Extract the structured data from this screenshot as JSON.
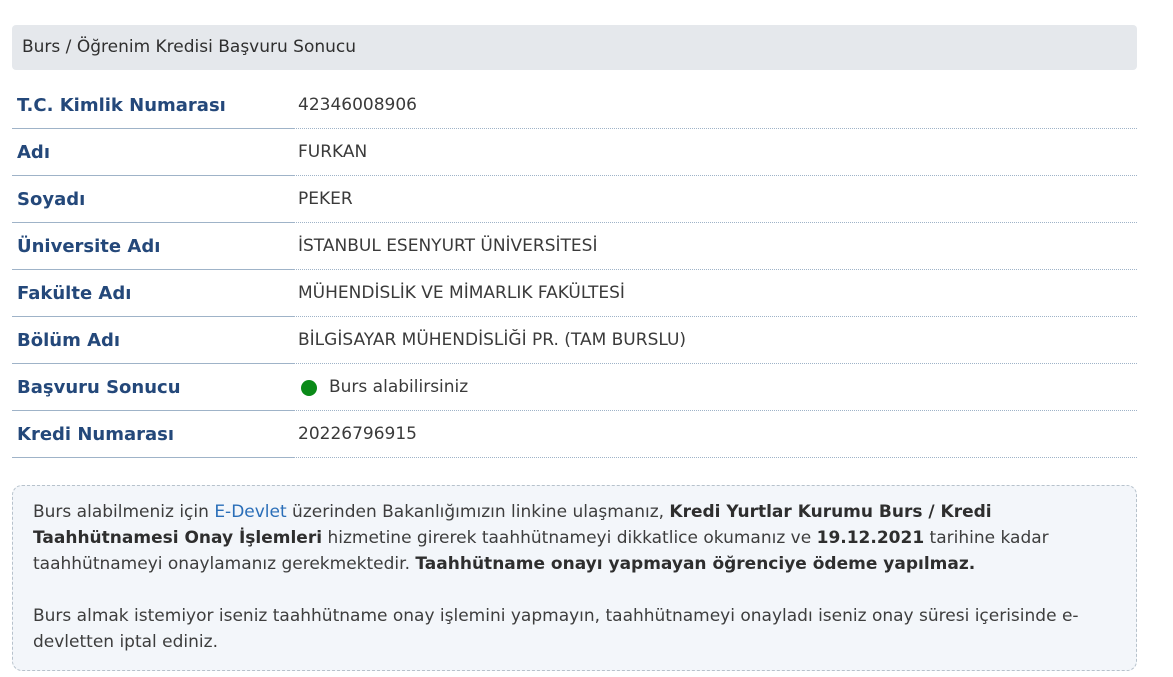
{
  "header": {
    "title": "Burs / Öğrenim Kredisi Başvuru Sonucu"
  },
  "rows": [
    {
      "label": "T.C. Kimlik Numarası",
      "value": "42346008906"
    },
    {
      "label": "Adı",
      "value": "FURKAN"
    },
    {
      "label": "Soyadı",
      "value": "PEKER"
    },
    {
      "label": "Üniversite Adı",
      "value": "İSTANBUL ESENYURT ÜNİVERSİTESİ"
    },
    {
      "label": "Fakülte Adı",
      "value": "MÜHENDİSLİK VE MİMARLIK FAKÜLTESİ"
    },
    {
      "label": "Bölüm Adı",
      "value": "BİLGİSAYAR MÜHENDİSLİĞİ PR. (TAM BURSLU)"
    },
    {
      "label": "Başvuru Sonucu",
      "value": "Burs alabilirsiniz",
      "status_color": "#0a8a18"
    },
    {
      "label": "Kredi Numarası",
      "value": "20226796915"
    }
  ],
  "info": {
    "p1_a": "Burs alabilmeniz için ",
    "p1_link": "E-Devlet",
    "p1_b": " üzerinden Bakanlığımızın linkine ulaşmanız, ",
    "p1_bold1": "Kredi Yurtlar Kurumu Burs / Kredi Taahhütnamesi Onay İşlemleri",
    "p1_c": " hizmetine girerek taahhütnameyi dikkatlice okumanız ve ",
    "p1_bold2": "19.12.2021",
    "p1_d": " tarihine kadar taahhütnameyi onaylamanız gerekmektedir. ",
    "p1_bold3": "Taahhütname onayı yapmayan öğrenciye ödeme yapılmaz.",
    "p2": "Burs almak istemiyor iseniz taahhütname onay işlemini yapmayın, taahhütnameyi onayladı iseniz onay süresi içerisinde e-devletten iptal ediniz."
  }
}
